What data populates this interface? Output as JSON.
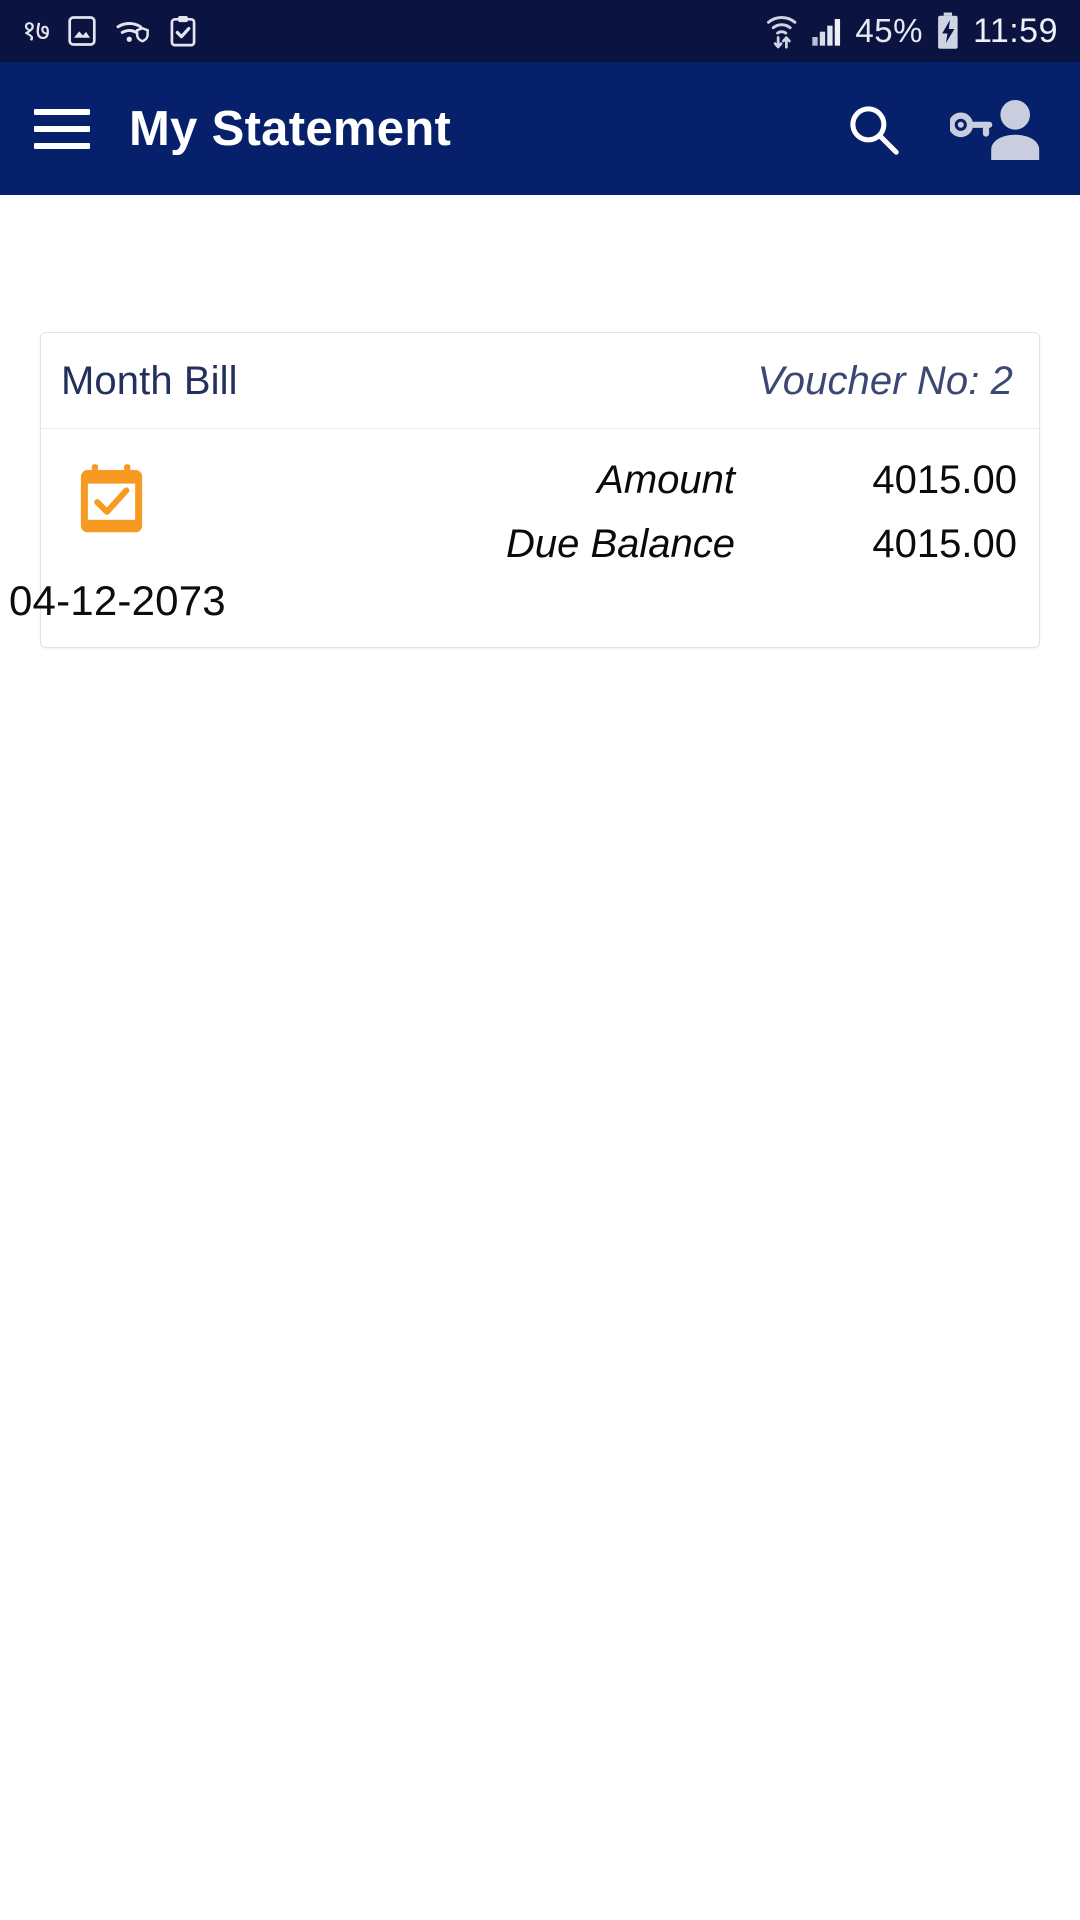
{
  "status_bar": {
    "left_icons": [
      {
        "name": "devanagari-badge-icon",
        "glyph": "१७"
      },
      {
        "name": "image-icon",
        "glyph": "image"
      },
      {
        "name": "wifi-secure-icon",
        "glyph": "wifi-shield"
      },
      {
        "name": "clipboard-check-icon",
        "glyph": "clipboard"
      }
    ],
    "wifi_label": "wifi-transfer-icon",
    "signal_label": "cellular-signal-icon",
    "battery_percent": "45%",
    "battery_state": "charging",
    "time": "11:59"
  },
  "app_bar": {
    "title": "My Statement",
    "menu_label": "menu-icon",
    "search_label": "search-icon",
    "account_label": "key-user-icon",
    "background": "#07206b"
  },
  "card": {
    "header": {
      "title": "Month Bill",
      "voucher": "Voucher No: 2"
    },
    "date_icon": "calendar-check-icon",
    "date_icon_color": "#f79a21",
    "rows": [
      {
        "label": "Amount",
        "value": "4015.00"
      },
      {
        "label": "Due Balance",
        "value": "4015.00"
      }
    ],
    "date": "04-12-2073"
  }
}
